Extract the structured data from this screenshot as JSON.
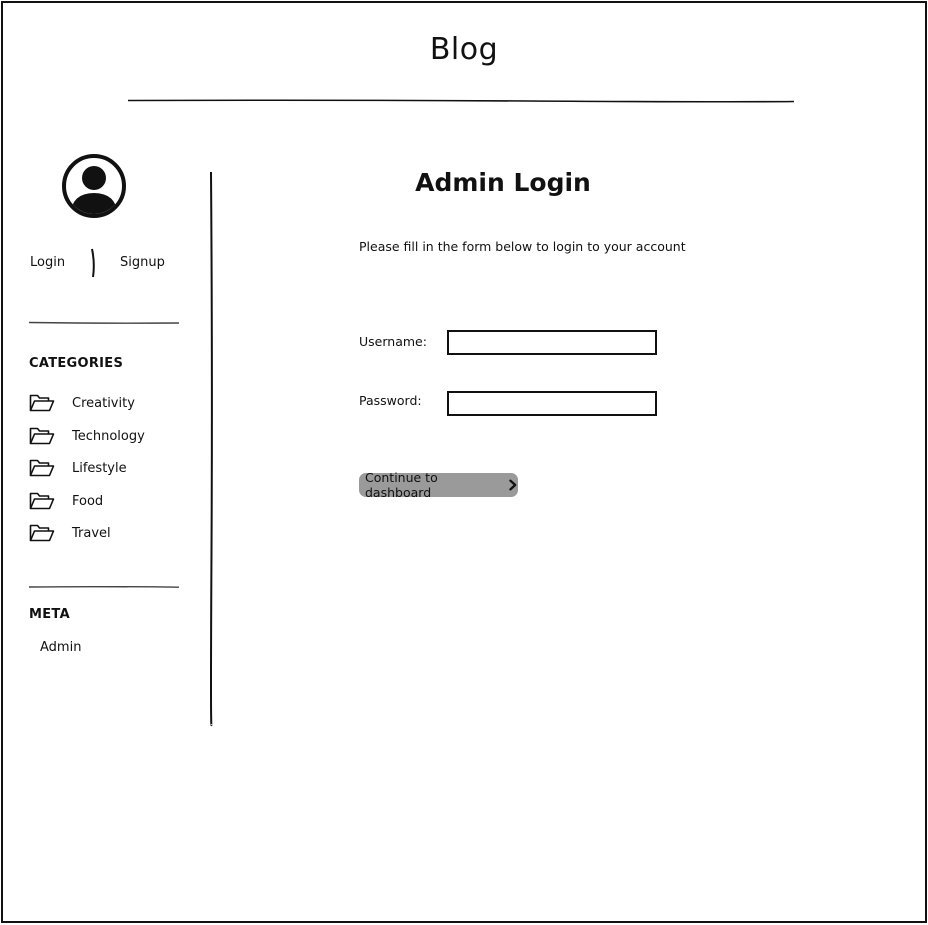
{
  "header": {
    "title": "Blog"
  },
  "sidebar": {
    "avatar_icon": "user-avatar-icon",
    "auth": {
      "login_label": "Login",
      "signup_label": "Signup"
    },
    "categories": {
      "heading": "CATEGORIES",
      "icon": "folder-icon",
      "items": [
        {
          "label": "Creativity"
        },
        {
          "label": "Technology"
        },
        {
          "label": "Lifestyle"
        },
        {
          "label": "Food"
        },
        {
          "label": "Travel"
        }
      ]
    },
    "meta": {
      "heading": "META",
      "items": [
        {
          "label": "Admin"
        }
      ]
    }
  },
  "main": {
    "title": "Admin Login",
    "instructions": "Please fill in the form below to login to your account",
    "form": {
      "username_label": "Username:",
      "username_value": "",
      "password_label": "Password:",
      "password_value": "",
      "submit_label": "Continue to dashboard",
      "submit_icon": "chevron-right-icon"
    }
  },
  "colors": {
    "ink": "#111111",
    "button_bg": "#9a9a9a",
    "background": "#ffffff"
  }
}
